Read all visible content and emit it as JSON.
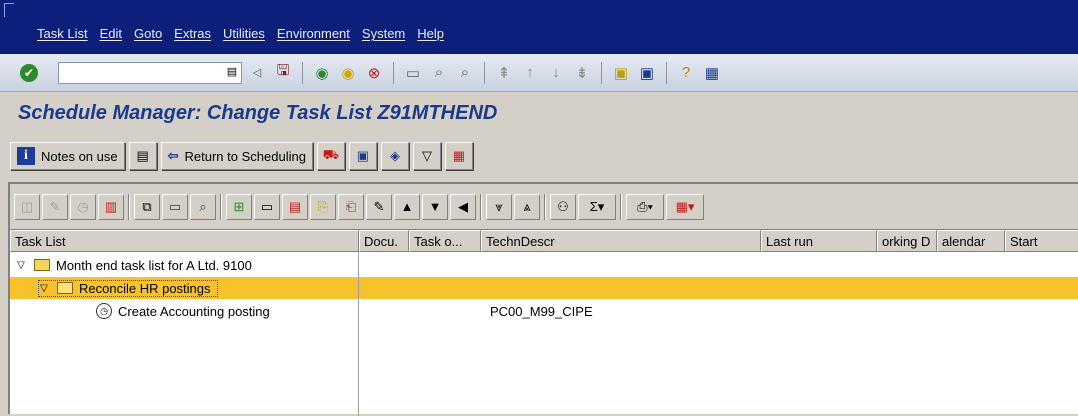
{
  "menu": [
    "Task List",
    "Edit",
    "Goto",
    "Extras",
    "Utilities",
    "Environment",
    "System",
    "Help"
  ],
  "command_field": {
    "value": ""
  },
  "title": "Schedule Manager: Change Task List Z91MTHEND",
  "app_toolbar": {
    "notes_label": "Notes on use",
    "return_label": "Return to Scheduling"
  },
  "columns": [
    "Task List",
    "Docu.",
    "Task o...",
    "TechnDescr",
    "Last run",
    "orking D",
    "alendar",
    "Start"
  ],
  "rows": [
    {
      "name": "Month end task list for A Ltd. 9100",
      "techn": ""
    },
    {
      "name": "Reconcile HR postings",
      "techn": ""
    },
    {
      "name": "Create Accounting posting",
      "techn": "PC00_M99_CIPE"
    }
  ]
}
